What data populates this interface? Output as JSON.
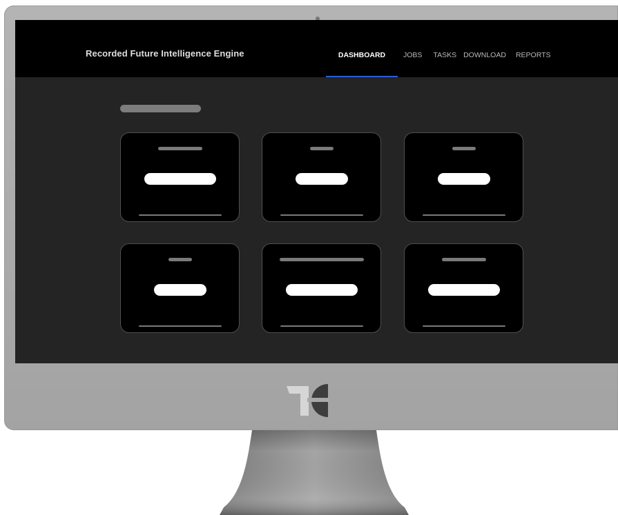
{
  "app": {
    "title": "Recorded Future Intelligence Engine"
  },
  "nav": {
    "items": [
      {
        "label": "DASHBOARD",
        "active": true
      },
      {
        "label": "JOBS",
        "active": false
      },
      {
        "label": "TASKS",
        "active": false
      },
      {
        "label": "DOWNLOAD",
        "active": false
      },
      {
        "label": "REPORTS",
        "active": false
      }
    ]
  },
  "colors": {
    "nav_background": "#000000",
    "screen_background": "#242424",
    "card_background": "#000000",
    "active_tab_underline": "#2b5fd9",
    "placeholder_grey": "#7a7a7a",
    "placeholder_value": "#ffffff"
  },
  "icons": {
    "camera": "webcam-dot-icon",
    "brand": "brand-logo-icon"
  }
}
